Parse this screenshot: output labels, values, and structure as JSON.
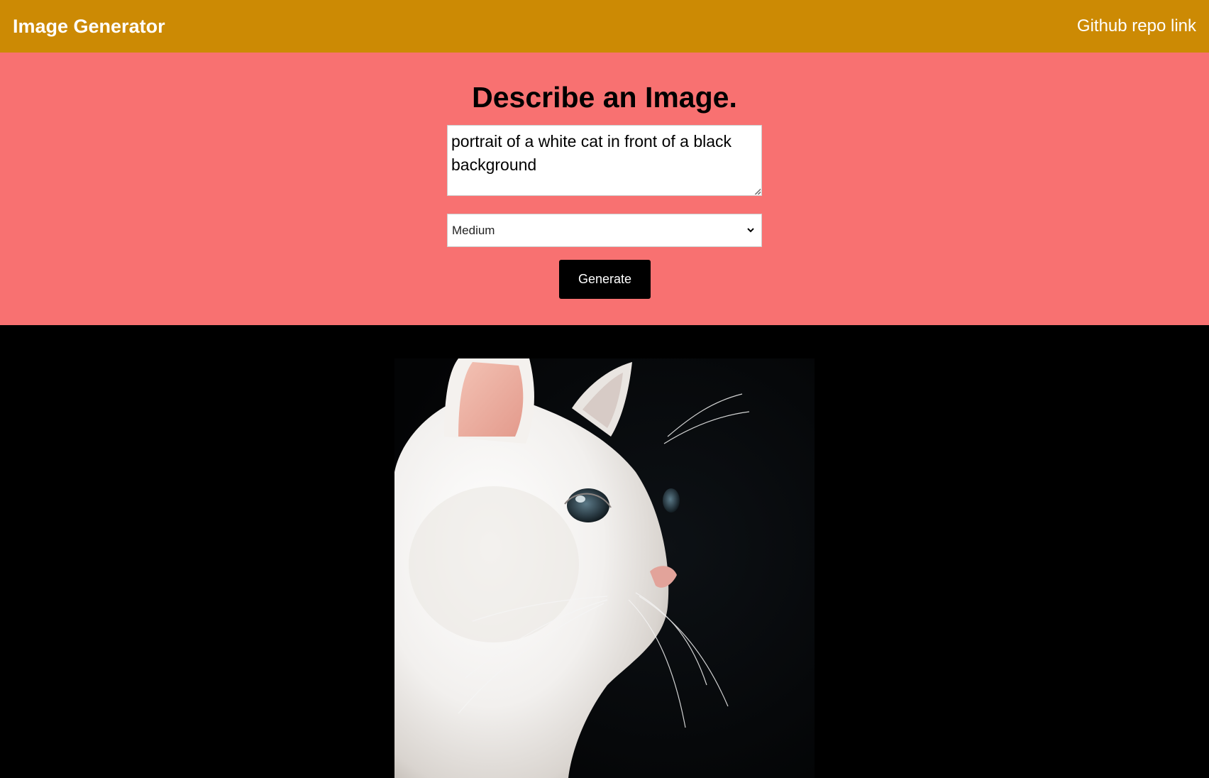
{
  "navbar": {
    "brand": "Image Generator",
    "link": "Github repo link",
    "color": "#cc8a04"
  },
  "form": {
    "heading": "Describe an Image.",
    "prompt_value": "portrait of a white cat in front of a black background",
    "size_selected": "Medium",
    "generate_label": "Generate",
    "background_color": "#f87171"
  },
  "result": {
    "background_color": "#000000"
  }
}
